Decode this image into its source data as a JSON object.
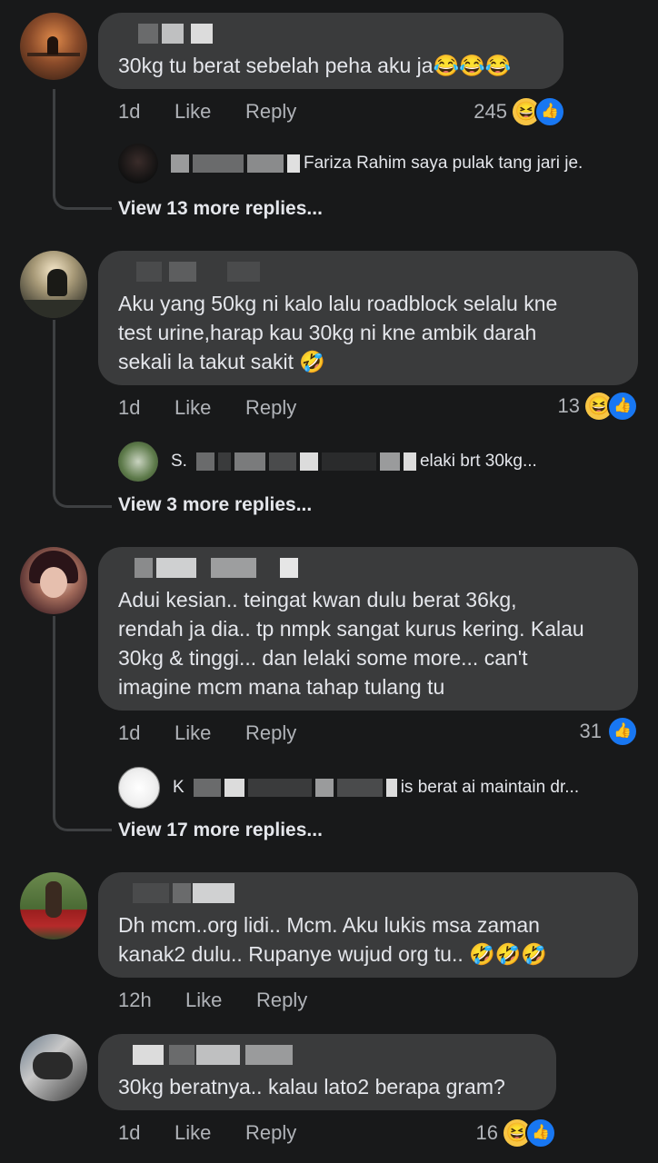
{
  "comments": [
    {
      "text": "30kg tu berat sebelah peha aku ja😂😂😂",
      "time": "1d",
      "like": "Like",
      "reply": "Reply",
      "reactions_count": "245",
      "reply_preview": "Fariza Rahim saya pulak tang jari je.",
      "view_more": "View 13 more replies..."
    },
    {
      "text": "Aku yang 50kg ni kalo lalu roadblock selalu kne\ntest urine,harap kau 30kg ni kne ambik darah\nsekali la takut sakit 🤣",
      "time": "1d",
      "like": "Like",
      "reply": "Reply",
      "reactions_count": "13",
      "reply_preview_start": "S.",
      "reply_preview": "elaki brt 30kg...",
      "view_more": "View 3 more replies..."
    },
    {
      "text": "Adui kesian.. teingat kwan dulu berat 36kg,\nrendah ja dia.. tp nmpk sangat kurus kering. Kalau\n30kg & tinggi... dan lelaki some more... can't\nimagine mcm mana tahap tulang tu",
      "time": "1d",
      "like": "Like",
      "reply": "Reply",
      "reactions_count": "31",
      "reply_preview_start": "K",
      "reply_preview": "is berat ai maintain dr...",
      "view_more": "View 17 more replies..."
    },
    {
      "text": "Dh mcm..org lidi.. Mcm. Aku lukis msa zaman\nkanak2 dulu.. Rupanye wujud org tu.. 🤣🤣🤣",
      "time": "12h",
      "like": "Like",
      "reply": "Reply"
    },
    {
      "text": "30kg beratnya.. kalau lato2 berapa gram?",
      "time": "1d",
      "like": "Like",
      "reply": "Reply",
      "reactions_count": "16"
    }
  ],
  "icons": {
    "haha": "😆",
    "like": "👍"
  },
  "colors": {
    "background": "#18191a",
    "bubble": "#3a3b3c",
    "like_blue": "#1877f2",
    "haha_yellow": "#f7c544"
  }
}
